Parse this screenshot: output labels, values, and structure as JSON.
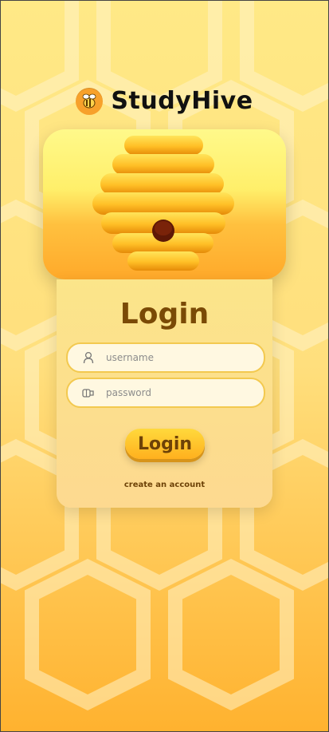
{
  "app": {
    "brand_name": "StudyHive",
    "logo_icon": "bee-icon",
    "hero_icon": "beehive-icon"
  },
  "login": {
    "title": "Login",
    "username_placeholder": "username",
    "username_icon": "user-icon",
    "password_placeholder": "password",
    "password_icon": "lock-icon",
    "submit_label": "Login",
    "create_account_label": "create an account"
  },
  "colors": {
    "accent": "#ffb01e",
    "title": "#7a4a06",
    "card": "#fbe58a",
    "background": "#ffd24a"
  }
}
